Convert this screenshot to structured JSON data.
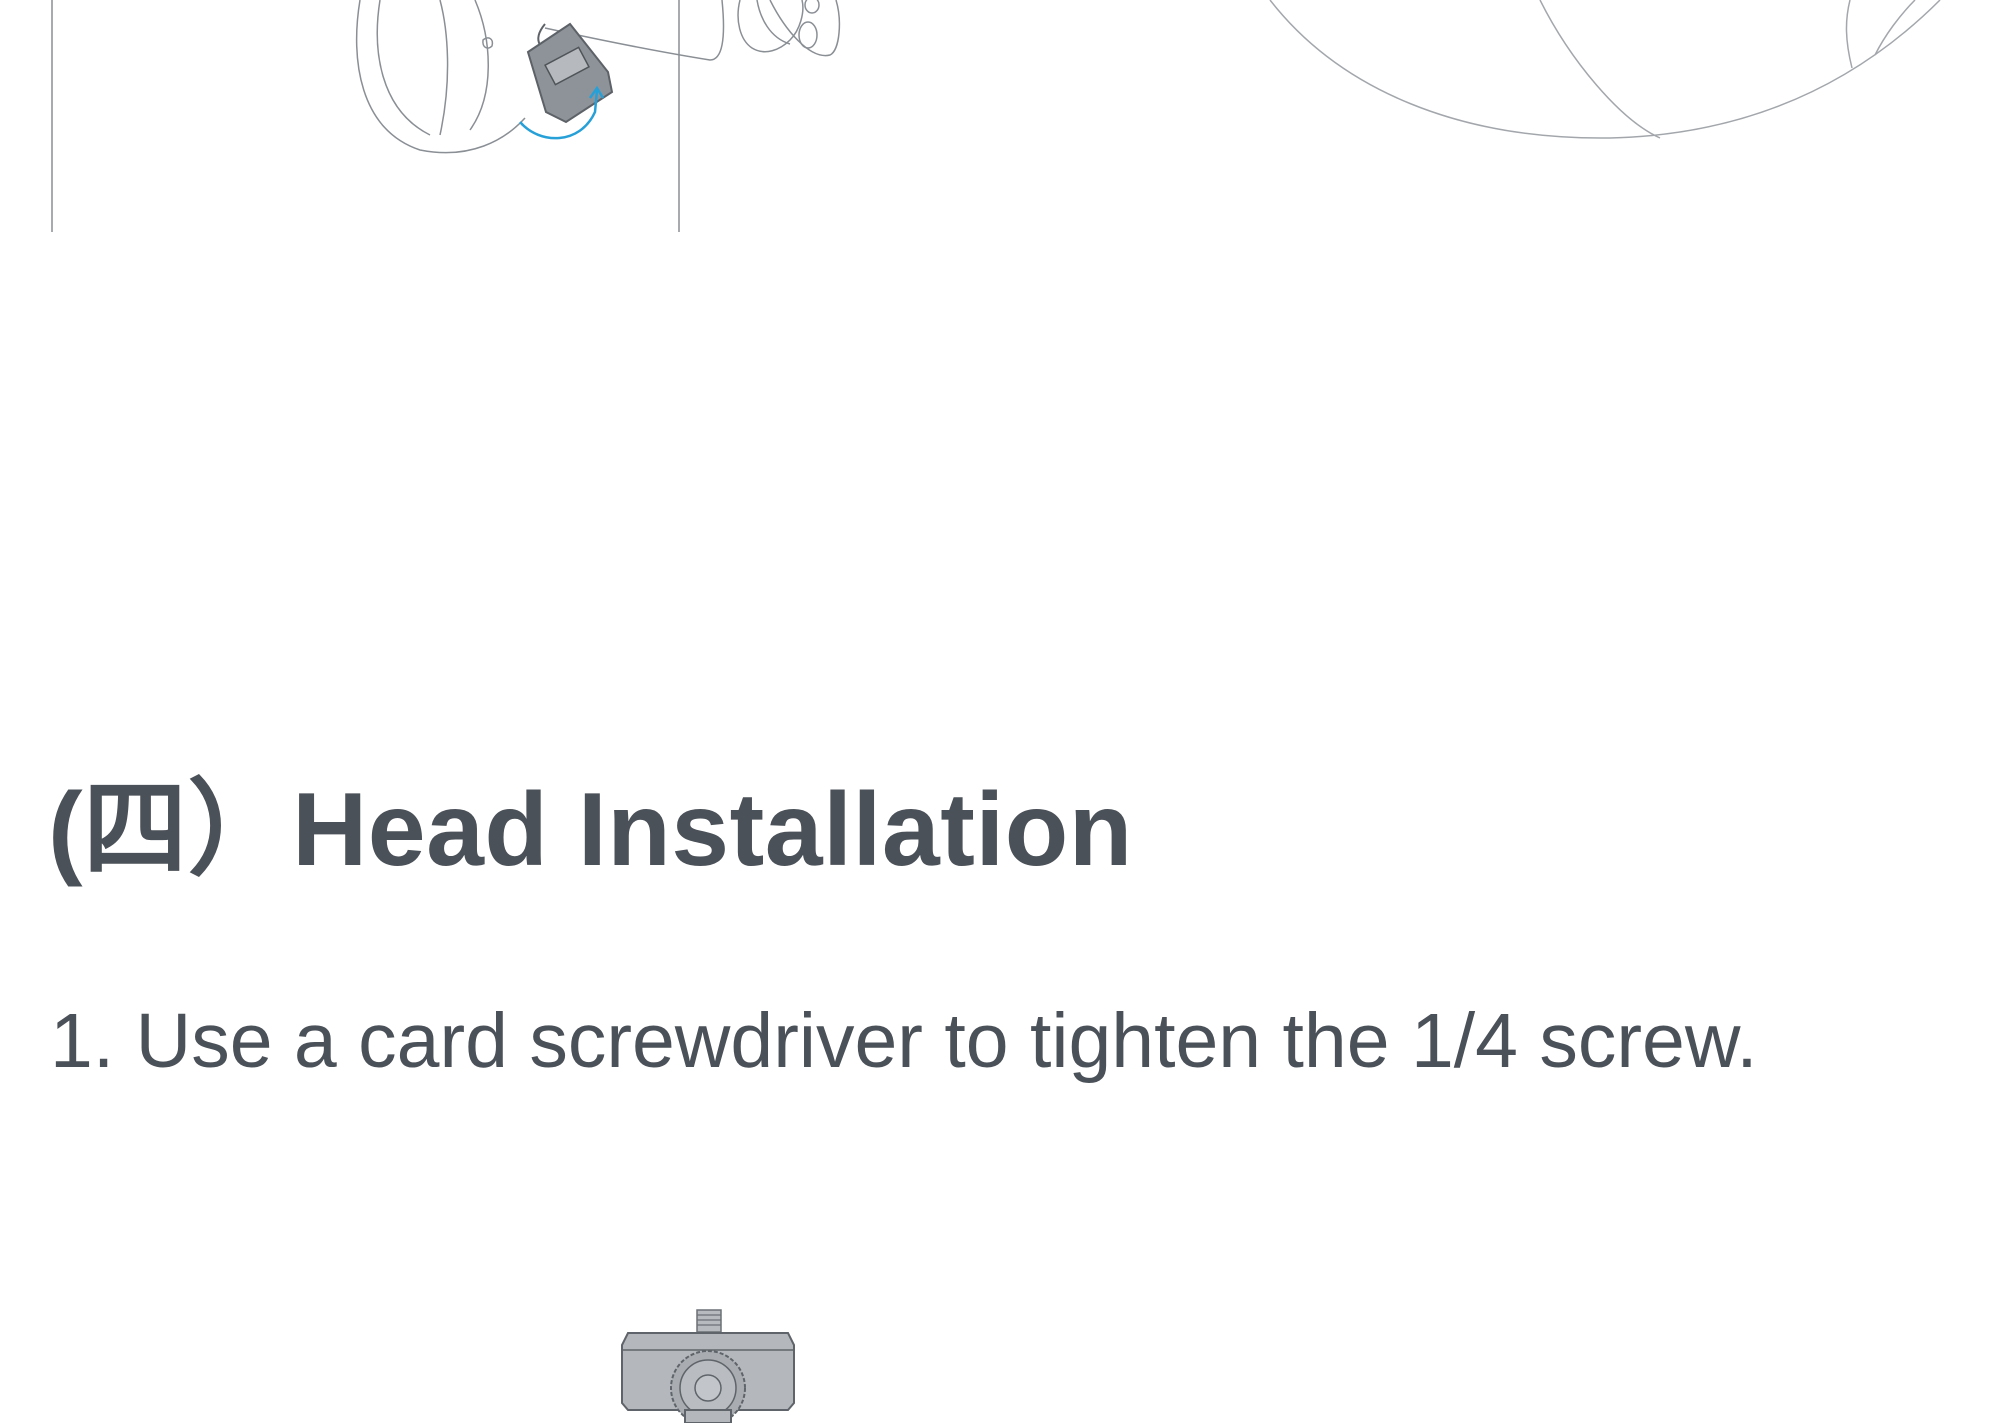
{
  "section": {
    "title": "(四）Head Installation"
  },
  "steps": [
    {
      "text": "1. Use a card screwdriver to tighten the 1/4 screw."
    }
  ]
}
